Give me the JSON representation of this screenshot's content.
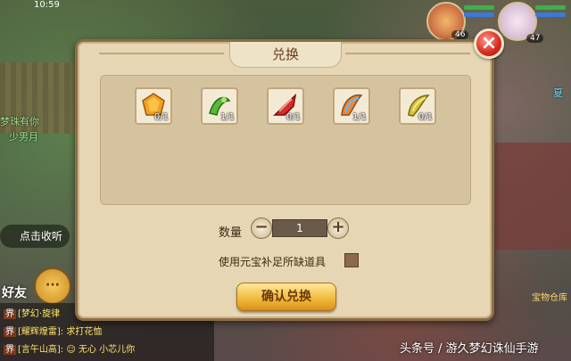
{
  "status_bar": {
    "time": "10:59"
  },
  "world": {
    "npc_lines": [
      "梦珠有你",
      "少男月"
    ],
    "npc_right": "夏",
    "badges": [
      "46",
      "47"
    ],
    "listen_button": "点击收听",
    "friend_label": "好友",
    "chat_button": "···",
    "chat_lines": [
      {
        "tag": "界",
        "text": "[梦幻·旋律"
      },
      {
        "tag": "界",
        "text": "[耀辉煌雷]: 求打花恤"
      },
      {
        "tag": "界",
        "text": "[言午山高]: ☺  无心  小芯儿你"
      }
    ],
    "right_tag": "宝物仓库"
  },
  "dialog": {
    "title": "兑换",
    "close_icon": "close-icon",
    "items": [
      {
        "icon": "orange-crystal-icon",
        "count": "0/1",
        "color": "#f0a020"
      },
      {
        "icon": "green-vine-icon",
        "count": "1/1",
        "color": "#5ab83a"
      },
      {
        "icon": "red-feather-icon",
        "count": "0/1",
        "color": "#d82a2a"
      },
      {
        "icon": "rainbow-wing-icon",
        "count": "1/1",
        "color": "#e88a3a"
      },
      {
        "icon": "golden-horn-icon",
        "count": "0/1",
        "color": "#d8c23a"
      }
    ],
    "quantity_label": "数量",
    "quantity_value": "1",
    "minus_label": "−",
    "plus_label": "+",
    "yuanbao_label": "使用元宝补足所缺道具",
    "confirm_label": "确认兑换"
  },
  "watermark": "头条号 / 游久梦幻诛仙手游"
}
